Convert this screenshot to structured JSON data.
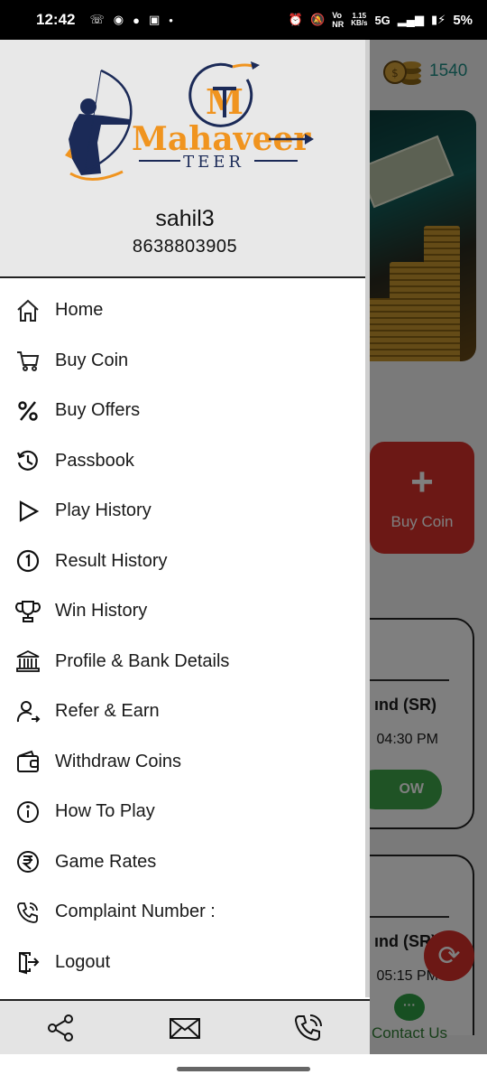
{
  "status_bar": {
    "time": "12:42",
    "network": "5G",
    "speed_value": "1.15",
    "speed_unit": "KB/s",
    "battery": "5%"
  },
  "background": {
    "coin_balance": "1540",
    "buy_coin_label": "Buy Coin",
    "card1_game": "ınd (SR)",
    "card1_time": "04:30 PM",
    "card1_button": "OW",
    "card2_game": "ınd (SR)",
    "card2_time": "05:15 PM",
    "contact_label": "Contact Us"
  },
  "drawer": {
    "logo_title": "Mahaveer",
    "logo_subtitle": "TEER",
    "logo_mark": "MT",
    "user_name": "sahil3",
    "user_phone": "8638803905",
    "menu": [
      {
        "label": "Home",
        "icon": "home-icon"
      },
      {
        "label": "Buy Coin",
        "icon": "cart-icon"
      },
      {
        "label": "Buy Offers",
        "icon": "percent-icon"
      },
      {
        "label": "Passbook",
        "icon": "history-icon"
      },
      {
        "label": "Play History",
        "icon": "play-icon"
      },
      {
        "label": "Result History",
        "icon": "number-one-icon"
      },
      {
        "label": "Win History",
        "icon": "trophy-icon"
      },
      {
        "label": "Profile & Bank Details",
        "icon": "bank-icon"
      },
      {
        "label": "Refer & Earn",
        "icon": "refer-user-icon"
      },
      {
        "label": "Withdraw Coins",
        "icon": "wallet-icon"
      },
      {
        "label": "How To Play",
        "icon": "info-icon"
      },
      {
        "label": "Game Rates",
        "icon": "rupee-icon"
      },
      {
        "label": "Complaint Number :",
        "icon": "phone-ring-icon"
      },
      {
        "label": "Logout",
        "icon": "logout-icon"
      }
    ],
    "share_bar": [
      "share-icon",
      "mail-icon",
      "phone-call-icon"
    ]
  },
  "colors": {
    "brand_orange": "#f0941f",
    "brand_navy": "#1b2a57",
    "accent_red": "#d9302b",
    "accent_teal": "#1f8f86"
  }
}
